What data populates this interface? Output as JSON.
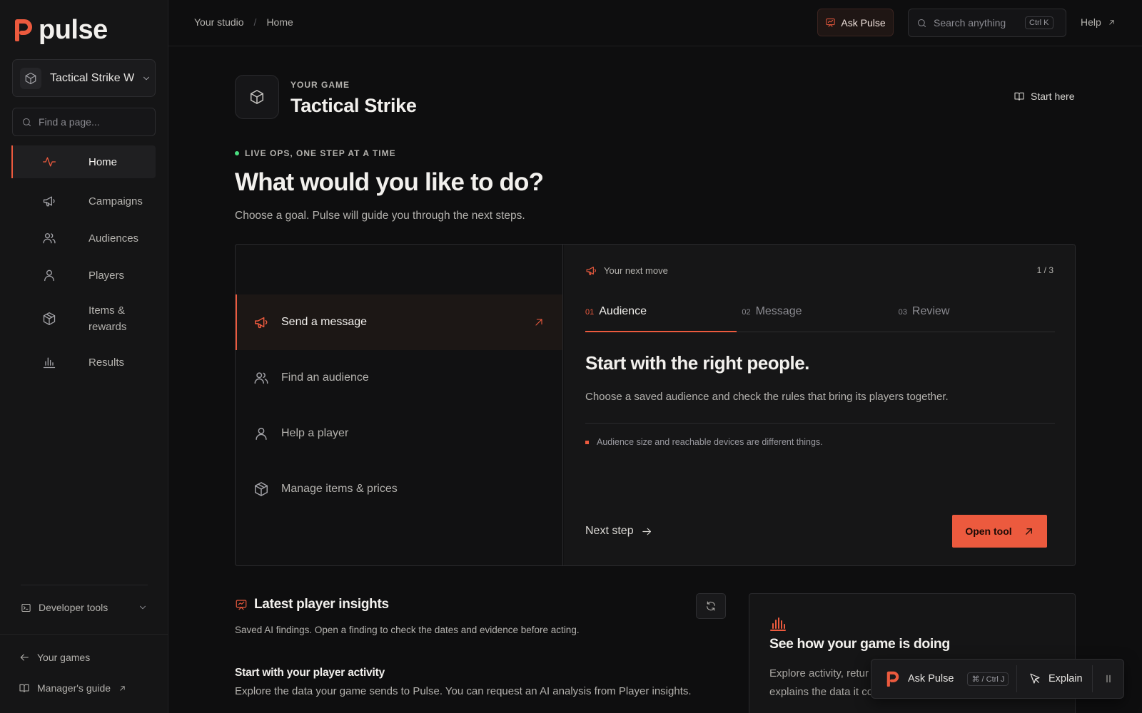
{
  "brand": {
    "name": "pulse",
    "accent": "#ec5a3e"
  },
  "sidebar": {
    "game_selector": {
      "label": "Tactical Strike W",
      "icon": "cube-icon"
    },
    "search": {
      "placeholder": "Find a page..."
    },
    "nav": [
      {
        "label": "Home",
        "icon": "activity-icon",
        "active": true
      },
      {
        "label": "Campaigns",
        "icon": "megaphone-icon"
      },
      {
        "label": "Audiences",
        "icon": "users-icon"
      },
      {
        "label": "Players",
        "icon": "user-icon"
      },
      {
        "label": "Items & rewards",
        "icon": "package-icon"
      },
      {
        "label": "Results",
        "icon": "bar-chart-icon"
      }
    ],
    "developer_tools": "Developer tools",
    "your_games": "Your games",
    "managers_guide": "Manager's guide"
  },
  "topbar": {
    "breadcrumb": [
      "Your studio",
      "Home"
    ],
    "ask_label": "Ask Pulse",
    "search_placeholder": "Search anything",
    "search_shortcut": "Ctrl K",
    "help_label": "Help"
  },
  "game": {
    "eyebrow": "YOUR GAME",
    "title": "Tactical Strike",
    "start_here": "Start here"
  },
  "hero": {
    "tagline": "LIVE OPS, ONE STEP AT A TIME",
    "title": "What would you like to do?",
    "subtitle": "Choose a goal. Pulse will guide you through the next steps."
  },
  "goals": [
    {
      "label": "Send a message",
      "icon": "megaphone-icon",
      "active": true
    },
    {
      "label": "Find an audience",
      "icon": "users-icon"
    },
    {
      "label": "Help a player",
      "icon": "user-icon"
    },
    {
      "label": "Manage items & prices",
      "icon": "package-icon"
    }
  ],
  "next_move": {
    "label": "Your next move",
    "count": "1 / 3",
    "steps": [
      {
        "num": "01",
        "label": "Audience",
        "active": true
      },
      {
        "num": "02",
        "label": "Message"
      },
      {
        "num": "03",
        "label": "Review"
      }
    ],
    "title": "Start with the right people.",
    "description": "Choose a saved audience and check the rules that bring its players together.",
    "note": "Audience size and reachable devices are different things.",
    "next_step": "Next step",
    "open_tool": "Open tool"
  },
  "insights": {
    "title": "Latest player insights",
    "subtitle": "Saved AI findings. Open a finding to check the dates and evidence before acting.",
    "section_title": "Start with your player activity",
    "section_text": "Explore the data your game sends to Pulse. You can request an AI analysis from Player insights."
  },
  "game_card": {
    "title": "See how your game is doing",
    "text_line1": "Explore activity, retur",
    "text_line2": "explains the data it co"
  },
  "float_bar": {
    "ask_label": "Ask Pulse",
    "shortcut": "⌘ / Ctrl J",
    "explain_label": "Explain"
  }
}
